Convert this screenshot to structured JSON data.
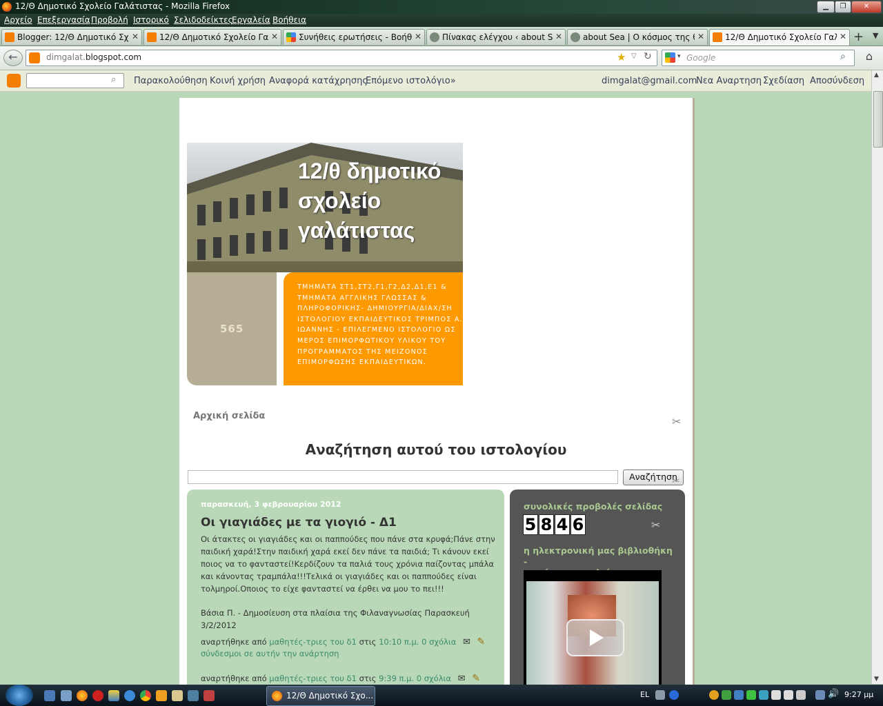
{
  "window": {
    "title": "12/Θ Δημοτικό Σχολείο Γαλάτιστας - Mozilla Firefox"
  },
  "menu": [
    "Αρχείο",
    "Επεξεργασία",
    "Προβολή",
    "Ιστορικό",
    "Σελιδοδείκτες",
    "Εργαλεία",
    "Βοήθεια"
  ],
  "tabs": [
    {
      "label": "Blogger: 12/Θ Δημοτικό Σχο...",
      "icon": "blogger-icon"
    },
    {
      "label": "12/Θ Δημοτικό Σχολείο Γαλά...",
      "icon": "blogger-icon"
    },
    {
      "label": "Συνήθεις ερωτήσεις - Βοήθε...",
      "icon": "google-icon"
    },
    {
      "label": "Πίνακας ελέγχου ‹ about Sea...",
      "icon": "wordpress-icon"
    },
    {
      "label": "about Sea | Ο κόσμος της θά...",
      "icon": "wordpress-icon"
    },
    {
      "label": "12/Θ Δημοτικό Σχολείο Γαλά...",
      "icon": "blogger-icon"
    }
  ],
  "navbar": {
    "url_prefix": "dimgalat.",
    "url_domain": "blogspot.com",
    "search_placeholder": "Google"
  },
  "blogger_nav": {
    "left_links": [
      "Παρακολούθηση",
      "Κοινή χρήση",
      "Αναφορά κατάχρησης",
      "Επόμενο ιστολόγιο»"
    ],
    "right_links": [
      "dimgalat@gmail.com",
      "Νεα Αναρτηση",
      "Σχεδίαση",
      "Αποσύνδεση"
    ]
  },
  "header": {
    "title_line1": "12/θ δημοτικό",
    "title_line2": "σχολείο",
    "title_line3": "γαλάτιστας",
    "number": "565",
    "description": "ΤΜΗΜΑΤΑ ΣΤ1,ΣΤ2,Γ1,Γ2,Δ2,Δ1,Ε1 & ΤΜΗΜΑΤΑ ΑΓΓΛΙΚΗΣ ΓΛΩΣΣΑΣ & ΠΛΗΡΟΦΟΡΙΚΗΣ- ΔΗΜΙΟΥΡΓΙΑ/ΔΙΑΧ/ΣΗ ΙΣΤΟΛΟΓΙΟΥ ΕΚΠΑΙΔΕΥΤΙΚΟΣ ΤΡΙΜΠΟΣ Α. ΙΩΑΝΝΗΣ - ΕΠΙΛΕΓΜΕΝΟ ΙΣΤΟΛΟΓΙΟ ΩΣ ΜΕΡΟΣ ΕΠΙΜΟΡΦΩΤΙΚΟΥ ΥΛΙΚΟΥ ΤΟΥ ΠΡΟΓΡΑΜΜΑΤΟΣ ΤΗΣ ΜΕΙΖΟΝΟΣ ΕΠΙΜΟΡΦΩΣΗΣ ΕΚΠΑΙΔΕΥΤΙΚΩΝ."
  },
  "home_link": "Αρχική σελίδα",
  "search_widget": {
    "title": "Αναζήτηση αυτού του ιστολογίου",
    "button": "Αναζήτηση"
  },
  "post": {
    "date": "παρασκευή, 3 φεβρουαρίου 2012",
    "title": "Οι γιαγιάδες με τα γιογιό - Δ1",
    "body_line1": "Οι άτακτες οι γιαγιάδες και οι παππούδες που πάνε στα κρυφά;Πάνε στην",
    "body_line2": "παιδική χαρά!Στην παιδική χαρά εκεί δεν πάνε τα παιδιά; Τι κάνουν εκεί",
    "body_line3": "ποιος να το φανταστεί!Κερδίζουν τα παλιά τους χρόνια παίζοντας μπάλα",
    "body_line4": "και κάνοντας τραμπάλα!!!Τελικά οι γιαγιάδες και οι παππούδες είναι",
    "body_line5": "τολμηροί.Οποιος το είχε φανταστεί να έρθει να μου το πει!!!",
    "signature_line1": "Βάσια Π. - Δημοσίευση στα πλαίσια της Φιλαναγνωσίας Παρασκευή",
    "signature_line2": "3/2/2012",
    "footer1": {
      "posted_by": "αναρτήθηκε από",
      "author": "μαθητές-τριες του δ1",
      "at": "στις",
      "time": "10:10 π.μ.",
      "comments": "0 σχόλια",
      "links": "σύνδεσμοι σε αυτήν την ανάρτηση"
    },
    "footer2": {
      "posted_by": "αναρτήθηκε από",
      "author": "μαθητές-τριες του δ1",
      "at": "στις",
      "time": "9:39 π.μ.",
      "comments": "0 σχόλια"
    }
  },
  "sidebar": {
    "pageviews_title": "συνολικές προβολές σελίδας",
    "pageviews_digits": [
      "5",
      "8",
      "4",
      "6"
    ],
    "library_title_line1": "η ηλεκτρονική μας βιβλιοθήκη -",
    "library_title_line2": "τα νέα του σχολείου μας"
  },
  "taskbar": {
    "task_label": "12/Θ Δημοτικό Σχο...",
    "lang": "EL",
    "clock": "9:27 μμ"
  },
  "colors": {
    "page_bg": "#b8d8b8",
    "header_orange": "#ff9900",
    "header_tan": "#b5ad94",
    "post_bg": "#b8d8b8",
    "sidebar_bg": "#555555",
    "sidebar_title": "#a8c890",
    "link_green": "#3a8a6a"
  }
}
